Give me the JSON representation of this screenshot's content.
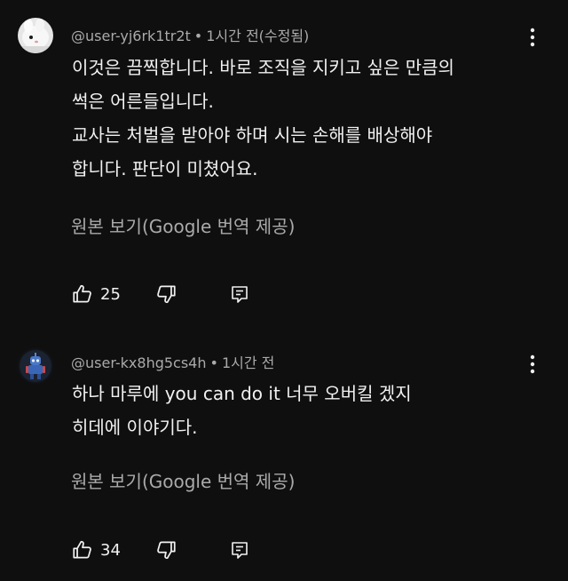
{
  "comments": [
    {
      "author": "@user-yj6rk1tr2t",
      "separator": "•",
      "time": "1시간 전(수정됨)",
      "body_lines": [
        "이것은 끔찍합니다. 바로 조직을 지키고 싶은 만큼의",
        "썩은 어른들입니다.",
        "교사는 처벌을 받아야 하며 시는 손해를 배상해야",
        "합니다. 판단이 미쳤어요."
      ],
      "translate_label": "원본 보기(Google 번역 제공)",
      "like_count": "25",
      "avatar": "white-rabbit-avatar"
    },
    {
      "author": "@user-kx8hg5cs4h",
      "separator": "•",
      "time": "1시간 전",
      "body_lines": [
        "하나 마루에 you can do it 너무 오버킬 겠지",
        "히데에 이야기다."
      ],
      "translate_label": "원본 보기(Google 번역 제공)",
      "like_count": "34",
      "avatar": "robot-figure-avatar"
    }
  ],
  "icons": {
    "more": "more-vert-icon",
    "like": "thumbs-up-icon",
    "dislike": "thumbs-down-icon",
    "reply": "comment-reply-icon"
  },
  "colors": {
    "background": "#0f0f0f",
    "primary_text": "#f1f1f1",
    "secondary_text": "#aaaaaa"
  }
}
